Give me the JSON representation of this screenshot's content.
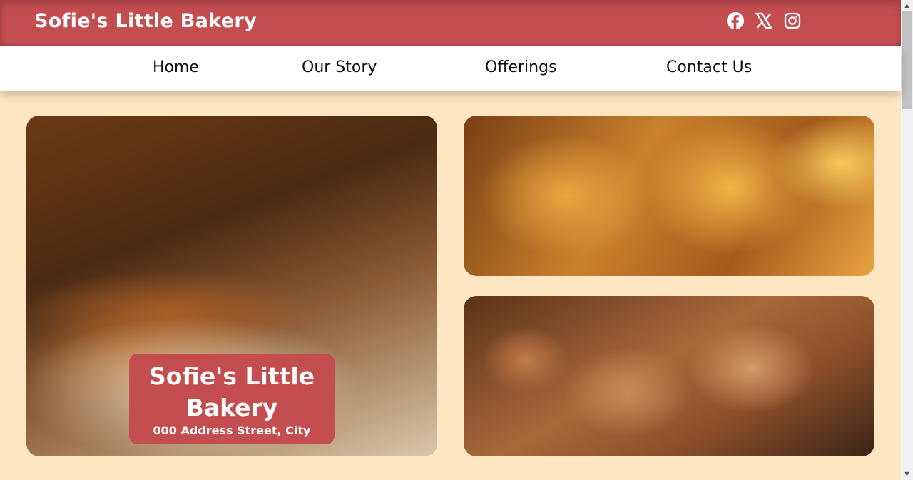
{
  "header": {
    "brand": "Sofie's Little Bakery",
    "socials": [
      "facebook-icon",
      "x-icon",
      "instagram-icon"
    ]
  },
  "nav": {
    "items": [
      "Home",
      "Our Story",
      "Offerings",
      "Contact Us"
    ]
  },
  "hero": {
    "title": "Sofie's Little Bakery",
    "address": "000 Address Street, City"
  },
  "images": {
    "left": "baguettes-image",
    "top_right": "croissants-image",
    "bottom_right": "pain-aux-raisins-image"
  },
  "colors": {
    "accent": "#c44d50",
    "background": "#fde6c1",
    "nav_background": "#ffffff"
  }
}
